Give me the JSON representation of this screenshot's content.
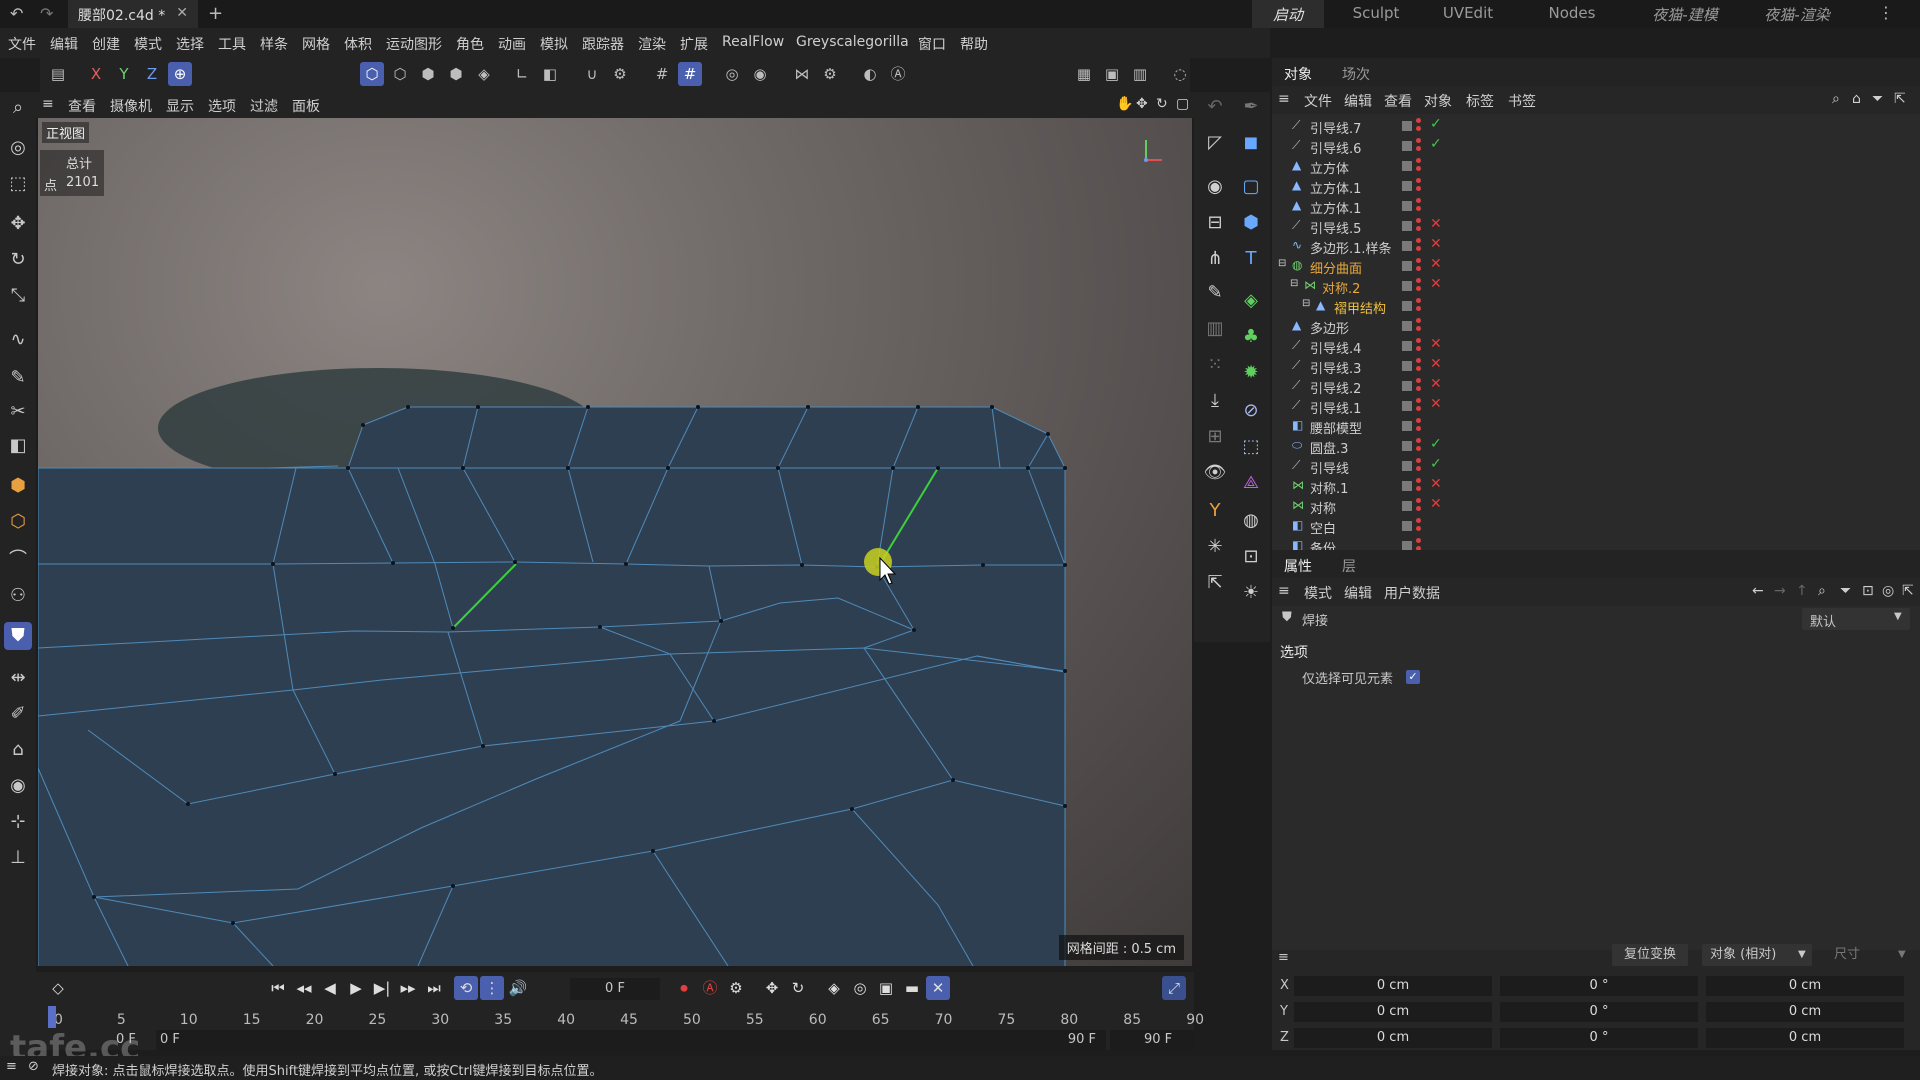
{
  "title_bar": {
    "file_tab": "腰部02.c4d *",
    "layouts": [
      "启动",
      "Sculpt",
      "UVEdit",
      "Nodes",
      "夜猫-建模",
      "夜猫-渲染"
    ]
  },
  "menu": [
    "文件",
    "编辑",
    "创建",
    "模式",
    "选择",
    "工具",
    "样条",
    "网格",
    "体积",
    "运动图形",
    "角色",
    "动画",
    "模拟",
    "跟踪器",
    "渲染",
    "扩展",
    "RealFlow",
    "Greyscalegorilla",
    "窗口",
    "帮助"
  ],
  "axis_buttons": [
    "X",
    "Y",
    "Z"
  ],
  "viewport": {
    "menu": [
      "查看",
      "摄像机",
      "显示",
      "选项",
      "过滤",
      "面板"
    ],
    "view_name": "正视图",
    "stats_label": "总计",
    "points_label": "点",
    "points_value": "2101",
    "grid_spacing": "网格间距 : 0.5 cm"
  },
  "object_manager": {
    "tabs": [
      "对象",
      "场次"
    ],
    "menu": [
      "文件",
      "编辑",
      "查看",
      "对象",
      "标签",
      "书签"
    ],
    "rows": [
      {
        "name": "引导线.7",
        "icon": "guide-line-icon",
        "state": "check",
        "indent": 0
      },
      {
        "name": "引导线.6",
        "icon": "guide-line-icon",
        "state": "check",
        "indent": 0
      },
      {
        "name": "立方体",
        "icon": "polygon-object-icon",
        "state": "",
        "indent": 0
      },
      {
        "name": "立方体.1",
        "icon": "polygon-object-icon",
        "state": "",
        "indent": 0
      },
      {
        "name": "立方体.1",
        "icon": "polygon-object-icon",
        "state": "",
        "indent": 0
      },
      {
        "name": "引导线.5",
        "icon": "guide-line-icon",
        "state": "cross",
        "indent": 0
      },
      {
        "name": "多边形.1.样条",
        "icon": "spline-icon",
        "state": "cross",
        "indent": 0
      },
      {
        "name": "细分曲面",
        "icon": "subdivision-icon",
        "state": "cross",
        "indent": 0,
        "highlight": "#e8a83a"
      },
      {
        "name": "对称.2",
        "icon": "symmetry-icon",
        "state": "cross",
        "indent": 1,
        "highlight": "#e8a83a"
      },
      {
        "name": "褶甲结构",
        "icon": "polygon-object-icon",
        "state": "",
        "indent": 2,
        "highlight": "#f0c040"
      },
      {
        "name": "多边形",
        "icon": "polygon-object-icon",
        "state": "",
        "indent": 0
      },
      {
        "name": "引导线.4",
        "icon": "guide-line-icon",
        "state": "cross",
        "indent": 0
      },
      {
        "name": "引导线.3",
        "icon": "guide-line-icon",
        "state": "cross",
        "indent": 0
      },
      {
        "name": "引导线.2",
        "icon": "guide-line-icon",
        "state": "cross",
        "indent": 0
      },
      {
        "name": "引导线.1",
        "icon": "guide-line-icon",
        "state": "cross",
        "indent": 0
      },
      {
        "name": "腰部模型",
        "icon": "null-object-icon",
        "state": "",
        "indent": 0
      },
      {
        "name": "圆盘.3",
        "icon": "disc-icon",
        "state": "check",
        "indent": 0
      },
      {
        "name": "引导线",
        "icon": "guide-line-icon",
        "state": "check",
        "indent": 0
      },
      {
        "name": "对称.1",
        "icon": "symmetry-icon",
        "state": "cross",
        "indent": 0
      },
      {
        "name": "对称",
        "icon": "symmetry-icon",
        "state": "cross",
        "indent": 0
      },
      {
        "name": "空白",
        "icon": "null-object-icon",
        "state": "",
        "indent": 0
      },
      {
        "name": "备份",
        "icon": "null-object-icon",
        "state": "",
        "indent": 0
      }
    ]
  },
  "attributes": {
    "tabs": [
      "属性",
      "层"
    ],
    "menu": [
      "模式",
      "编辑",
      "用户数据"
    ],
    "tool_name": "焊接",
    "preset": "默认",
    "section": "选项",
    "option_label": "仅选择可见元素",
    "option_checked": true
  },
  "coordinates": {
    "reset_button": "复位变换",
    "mode": "对象 (相对)",
    "size_label": "尺寸",
    "rows": [
      {
        "axis": "X",
        "pos": "0 cm",
        "rot": "0 °",
        "size": "0 cm"
      },
      {
        "axis": "Y",
        "pos": "0 cm",
        "rot": "0 °",
        "size": "0 cm"
      },
      {
        "axis": "Z",
        "pos": "0 cm",
        "rot": "0 °",
        "size": "0 cm"
      }
    ]
  },
  "timeline": {
    "current_frame": "0 F",
    "ruler": [
      "0",
      "5",
      "10",
      "15",
      "20",
      "25",
      "30",
      "35",
      "40",
      "45",
      "50",
      "55",
      "60",
      "65",
      "70",
      "75",
      "80",
      "85",
      "90"
    ],
    "start": "0 F",
    "start2": "0 F",
    "end": "90 F",
    "end2": "90 F"
  },
  "status": "焊接对象: 点击鼠标焊接选取点。使用Shift键焊接到平均点位置, 或按Ctrl键焊接到目标点位置。",
  "watermark": "tafe.cc"
}
